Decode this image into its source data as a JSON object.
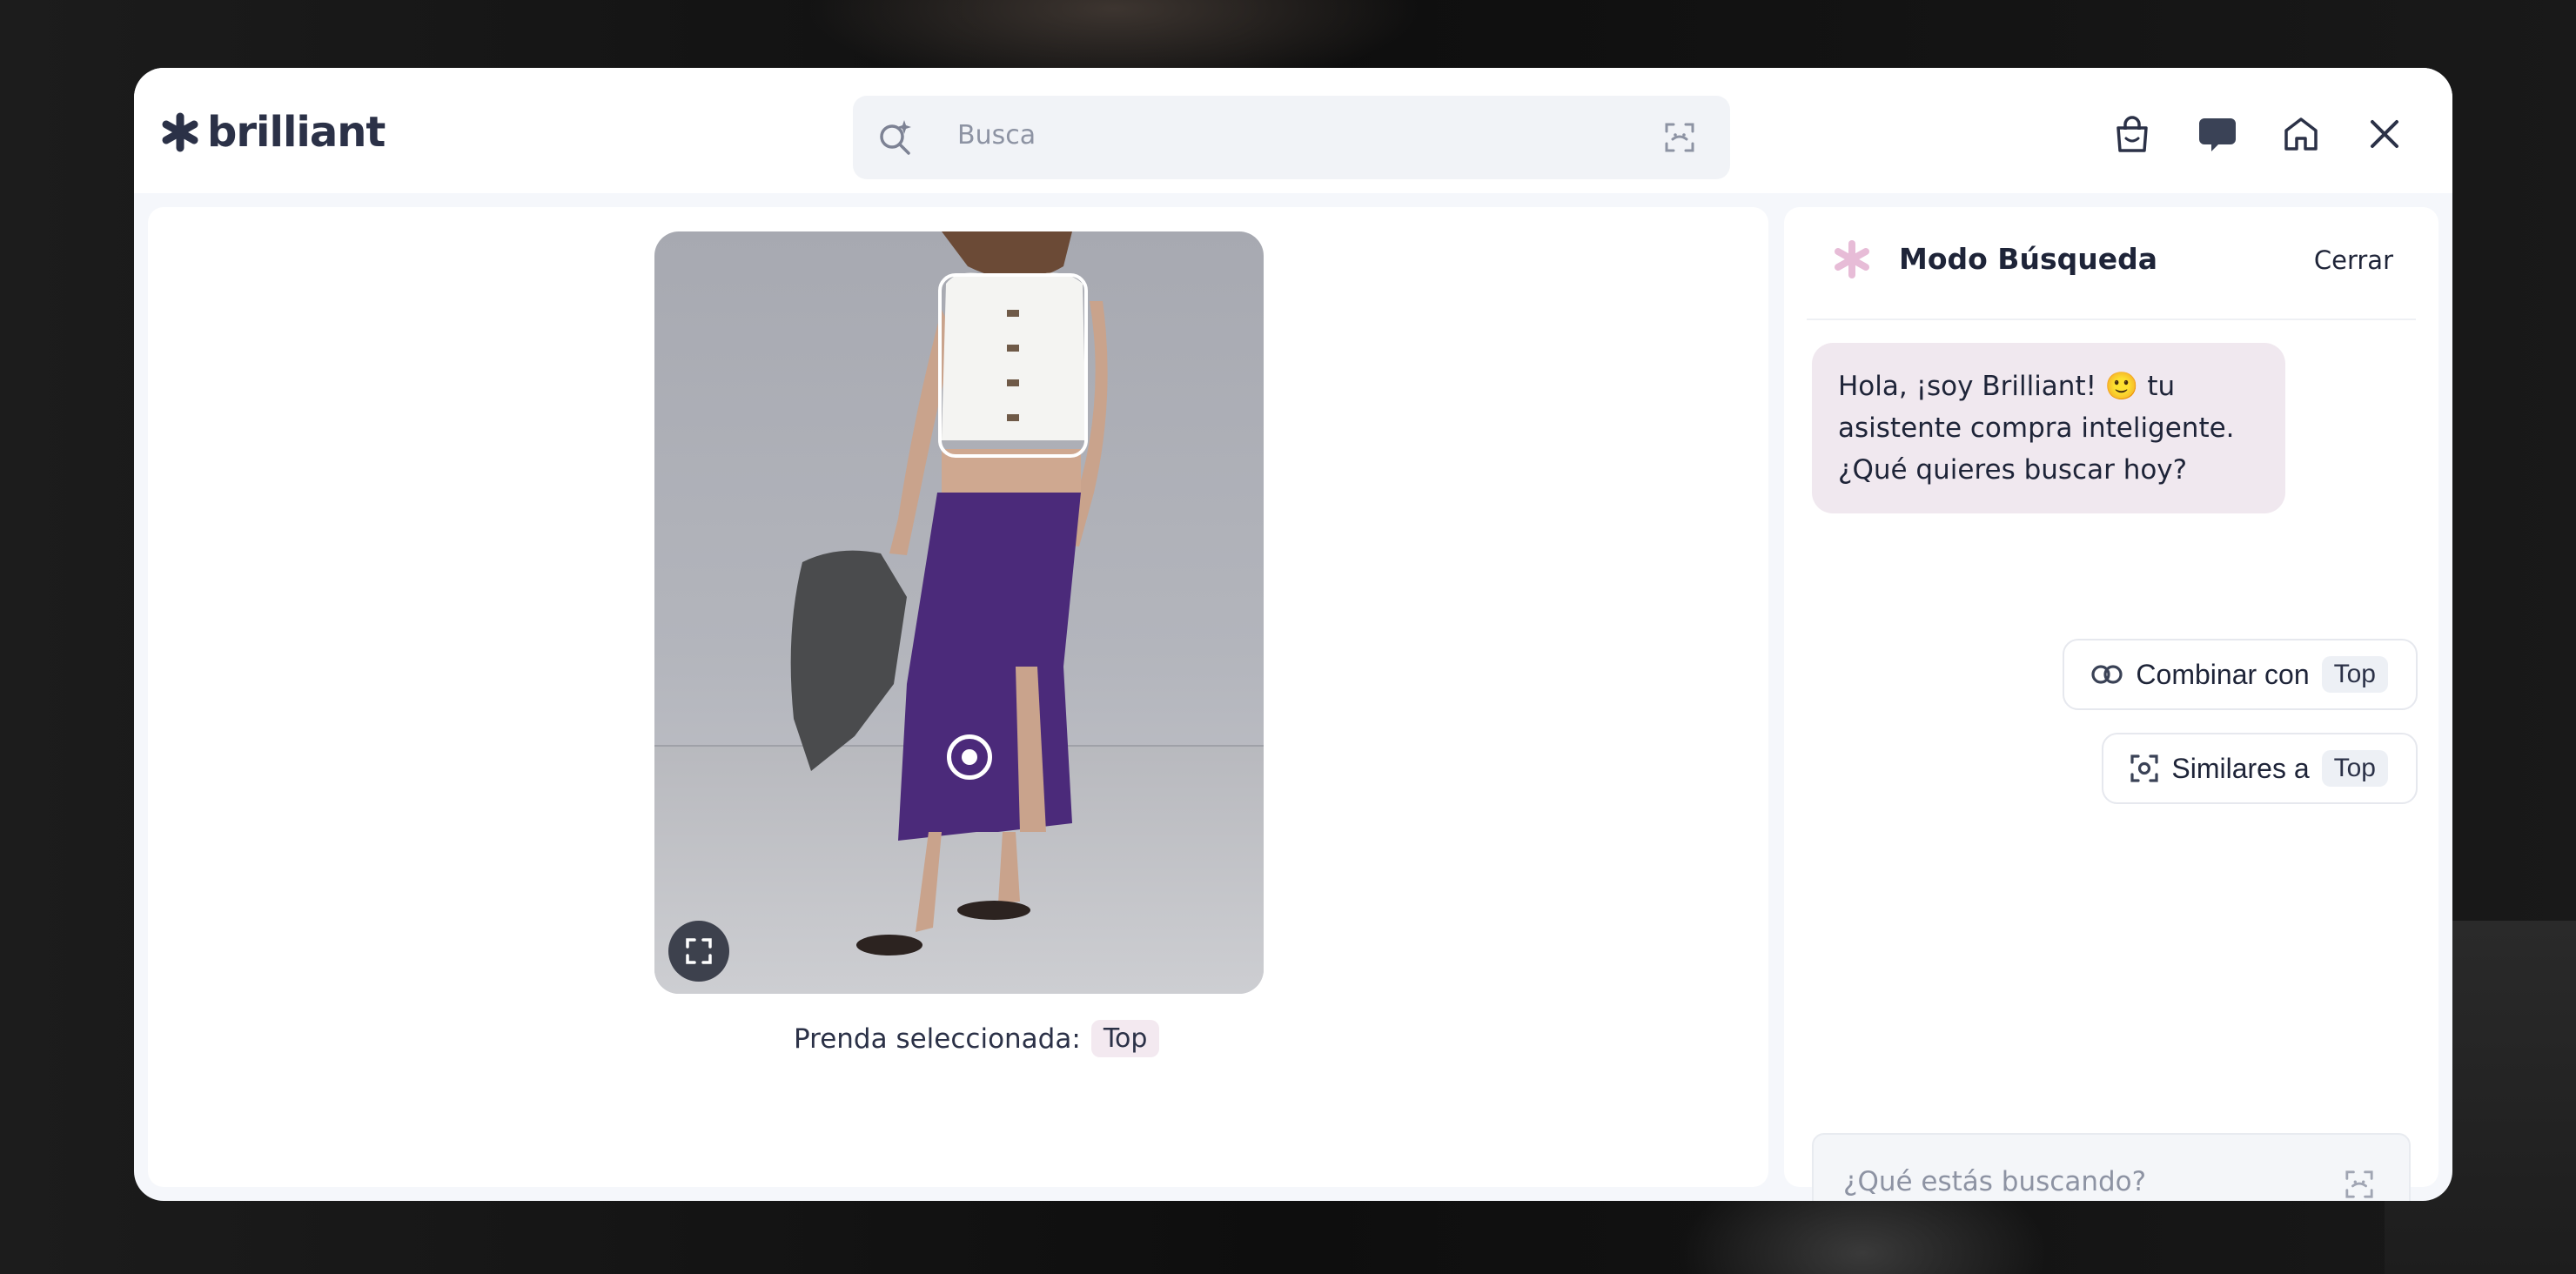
{
  "header": {
    "brand": "brilliant",
    "search_placeholder": "Busca"
  },
  "image_panel": {
    "caption_prefix": "Prenda seleccionada:",
    "selected_garment": "Top"
  },
  "assistant": {
    "title": "Modo Búsqueda",
    "close_label": "Cerrar",
    "greeting": "Hola, ¡soy Brilliant! 🙂 tu asistente compra inteligente. ¿Qué quieres buscar hoy?",
    "actions": [
      {
        "label": "Combinar con",
        "tag": "Top"
      },
      {
        "label": "Similares a",
        "tag": "Top"
      }
    ],
    "input_placeholder": "¿Qué estás buscando?"
  },
  "colors": {
    "brand_dark": "#2b3147",
    "sparkle_pink": "#e7bcd7",
    "chip_pink": "#f3e9f0",
    "bubble_bg": "#f0e8ef"
  },
  "icons": [
    "asterisk-logo-icon",
    "sparkle-search-icon",
    "scan-icon",
    "shopping-bag-icon",
    "chat-bubble-icon",
    "home-icon",
    "close-icon",
    "expand-icon",
    "rings-icon",
    "focus-scan-icon"
  ]
}
